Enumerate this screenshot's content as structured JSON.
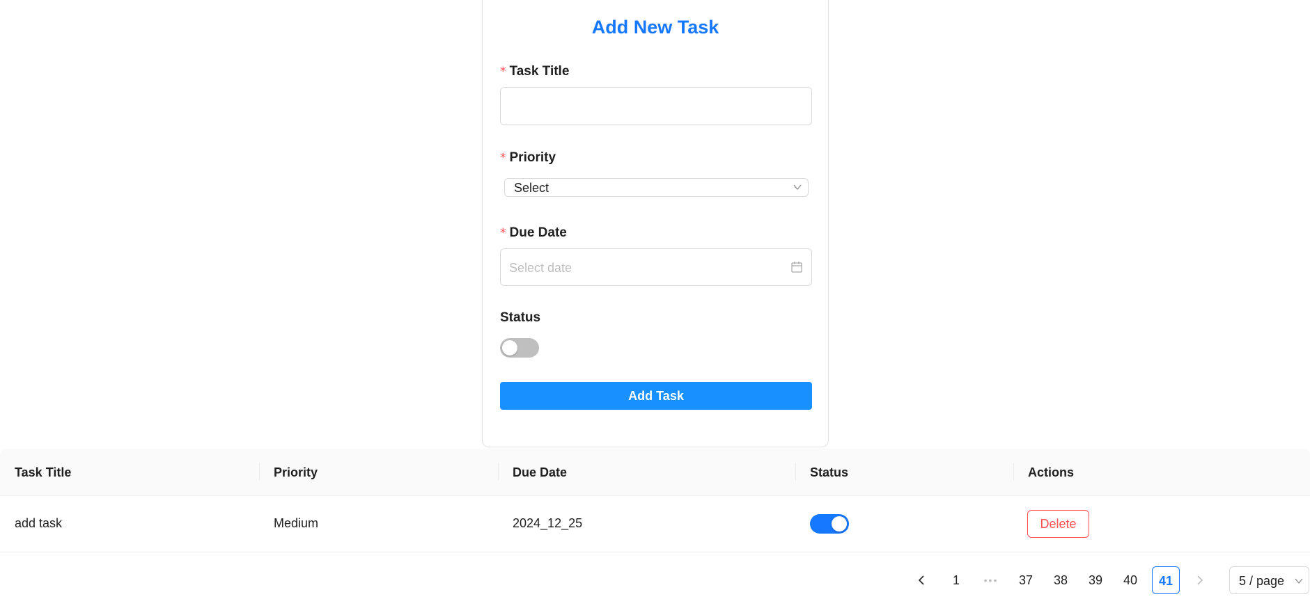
{
  "form": {
    "title": "Add New Task",
    "required_mark": "*",
    "task_title_label": "Task Title",
    "task_title_value": "",
    "priority_label": "Priority",
    "priority_value": "Select",
    "due_date_label": "Due Date",
    "due_date_placeholder": "Select date",
    "status_label": "Status",
    "status_on": false,
    "submit_label": "Add Task"
  },
  "table": {
    "columns": [
      "Task Title",
      "Priority",
      "Due Date",
      "Status",
      "Actions"
    ],
    "rows": [
      {
        "title": "add task",
        "priority": "Medium",
        "due_date": "2024_12_25",
        "status_on": true,
        "action_label": "Delete"
      }
    ]
  },
  "pagination": {
    "pages": [
      "1",
      "37",
      "38",
      "39",
      "40",
      "41"
    ],
    "current_page": "41",
    "ellipsis": "•••",
    "page_size_label": "5 / page"
  },
  "colors": {
    "primary": "#1677ff",
    "danger": "#ff4d4f",
    "switch_off": "#bfbfbf"
  }
}
